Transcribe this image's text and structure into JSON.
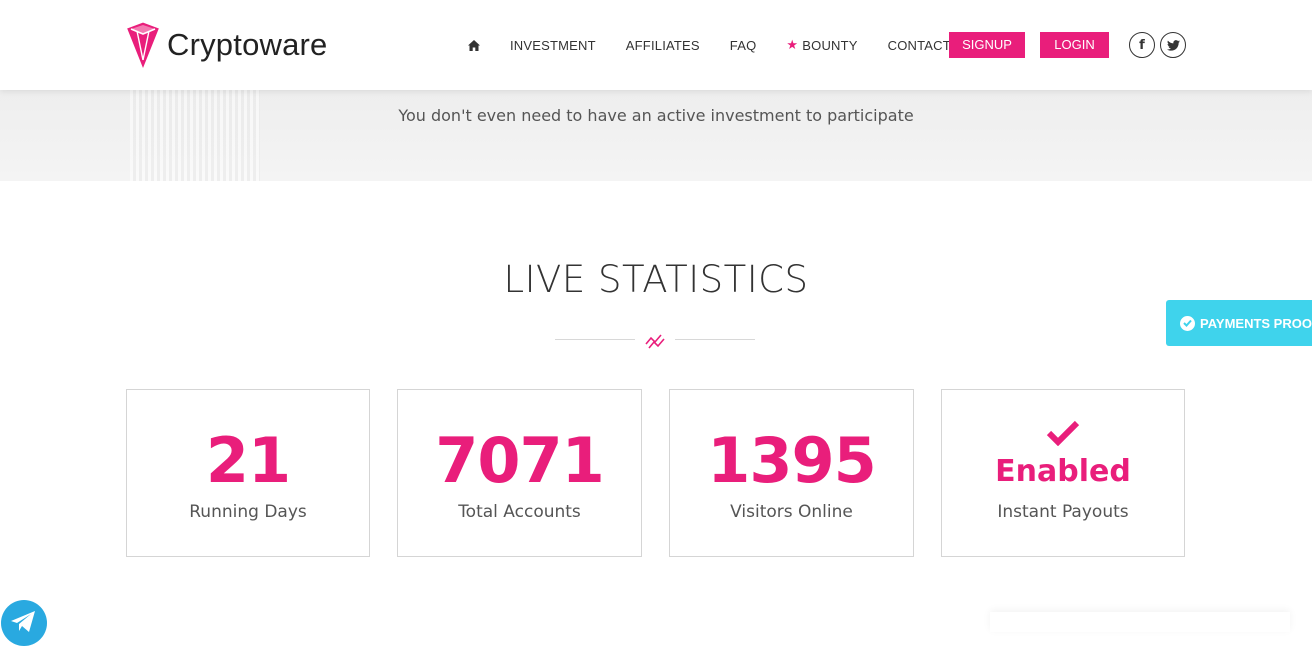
{
  "brand": {
    "name": "Cryptoware",
    "accent": "#e91e7b"
  },
  "nav": {
    "home_icon": "home-icon",
    "items": [
      {
        "label": "INVESTMENT"
      },
      {
        "label": "AFFILIATES"
      },
      {
        "label": "FAQ"
      },
      {
        "label": "BOUNTY",
        "icon": "star-icon"
      },
      {
        "label": "CONTACT"
      }
    ],
    "signup_label": "SIGNUP",
    "login_label": "LOGIN",
    "social": [
      "facebook-icon",
      "twitter-icon"
    ]
  },
  "band": {
    "text": "You don't even need to have an active investment to participate"
  },
  "stats": {
    "title": "LIVE STATISTICS",
    "divider_icon": "chart-line-icon",
    "items": [
      {
        "value": "21",
        "label": "Running Days"
      },
      {
        "value": "7071",
        "label": "Total Accounts"
      },
      {
        "value": "1395",
        "label": "Visitors Online"
      },
      {
        "value": "Enabled",
        "label": "Instant Payouts",
        "icon": "checkmark-icon"
      }
    ]
  },
  "proof_tab": {
    "label": "PAYMENTS PROOF",
    "icon": "check-circle-icon",
    "color": "#3fd3ec"
  },
  "telegram": {
    "icon": "telegram-icon",
    "color": "#29a9e0"
  }
}
